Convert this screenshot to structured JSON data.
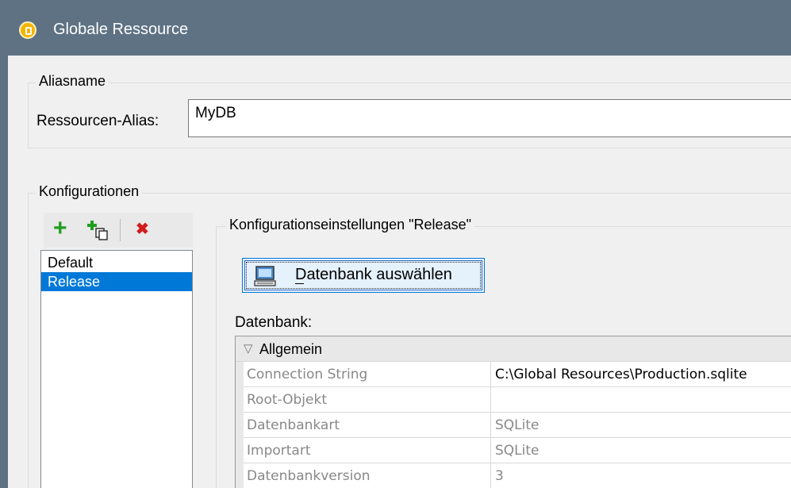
{
  "window": {
    "title": "Globale Ressource"
  },
  "alias_group": {
    "label": "Aliasname",
    "field_label": "Ressourcen-Alias:",
    "value": "MyDB"
  },
  "config_group": {
    "label": "Konfigurationen",
    "toolbar": {
      "add": "+",
      "copy": "copy",
      "delete": "✖"
    },
    "items": [
      {
        "label": "Default",
        "selected": false
      },
      {
        "label": "Release",
        "selected": true
      }
    ]
  },
  "settings": {
    "label": "Konfigurationseinstellungen \"Release\"",
    "select_db_button": "Datenbank auswählen",
    "db_label": "Datenbank:"
  },
  "grid": {
    "section": "Allgemein",
    "rows": [
      {
        "name": "Connection String",
        "value": "C:\\Global Resources\\Production.sqlite",
        "editable": true
      },
      {
        "name": "Root-Objekt",
        "value": "",
        "editable": false
      },
      {
        "name": "Datenbankart",
        "value": "SQLite",
        "editable": false
      },
      {
        "name": "Importart",
        "value": "SQLite",
        "editable": false
      },
      {
        "name": "Datenbankversion",
        "value": "3",
        "editable": false
      }
    ]
  },
  "colors": {
    "titlebar": "#5e7284",
    "selection": "#0078d7"
  }
}
